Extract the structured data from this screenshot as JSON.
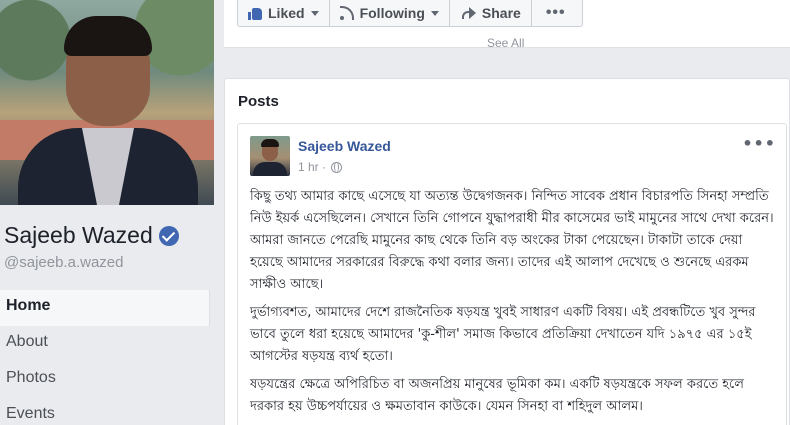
{
  "profile": {
    "name": "Sajeeb Wazed",
    "handle": "@sajeeb.a.wazed"
  },
  "nav": {
    "items": [
      {
        "label": "Home"
      },
      {
        "label": "About"
      },
      {
        "label": "Photos"
      },
      {
        "label": "Events"
      }
    ]
  },
  "actions": {
    "liked": "Liked",
    "following": "Following",
    "share": "Share",
    "more": "•••"
  },
  "about_card": {
    "see_all": "See All"
  },
  "posts": {
    "heading": "Posts",
    "post": {
      "author": "Sajeeb Wazed",
      "time": "1 hr ·",
      "options": "•••",
      "paragraphs": [
        "কিছু তথ্য আমার কাছে এসেছে যা অত্যন্ত উদ্বেগজনক। নিন্দিত সাবেক প্রধান বিচারপতি সিনহা সম্প্রতি নিউ ইয়র্ক এসেছিলেন। সেখানে তিনি গোপনে যুদ্ধাপরাধী মীর কাসেমের ভাই মামুনের সাথে দেখা করেন। আমরা জানতে পেরেছি মামুনের কাছ থেকে তিনি বড় অংকের টাকা পেয়েছেন। টাকাটা তাকে দেয়া হয়েছে আমাদের সরকারের বিরুদ্ধে কথা বলার জন্য। তাদের এই আলাপ দেখেছে ও শুনেছে এরকম সাক্ষীও আছে।",
        "দুর্ভাগ্যবশত, আমাদের দেশে রাজনৈতিক ষড়যন্ত্র খুবই সাধারণ একটি বিষয়। এই প্রবন্ধটিতে খুব সুন্দর ভাবে তুলে ধরা হয়েছে আমাদের 'কু-শীল' সমাজ কিভাবে প্রতিক্রিয়া দেখাতেন যদি ১৯৭৫ এর ১৫ই আগস্টের ষড়যন্ত্র ব্যর্থ হতো।",
        "ষড়যন্ত্রের ক্ষেত্রে অপিরিচিত বা অজনপ্রিয় মানুষের ভূমিকা কম। একটি ষড়যন্ত্রকে সফল করতে হলে দরকার হয় উচ্চপর্যায়ের ও ক্ষমতাবান কাউকে। যেমন সিনহা বা শহিদুল আলম।"
      ]
    }
  },
  "colors": {
    "brand": "#4267b2",
    "link": "#365899",
    "background": "#e9ebee"
  }
}
